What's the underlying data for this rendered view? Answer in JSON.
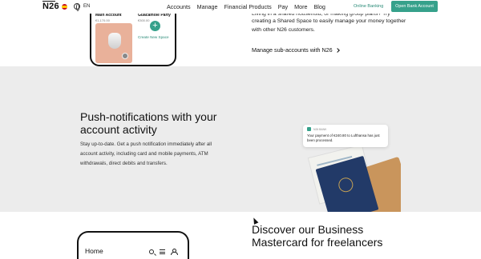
{
  "nav": {
    "logo": "N26",
    "language": "EN",
    "menu": [
      "Accounts",
      "Manage",
      "Financial Products",
      "Pay",
      "More",
      "Blog"
    ],
    "online_banking": "Online Banking",
    "open_account": "Open Bank Account"
  },
  "phone_top": {
    "accounts": [
      {
        "name": "Main Account",
        "amount": "€1,170.00"
      },
      {
        "name": "Guacamole Party",
        "amount": "€300.00"
      }
    ],
    "create_label": "Create New Space"
  },
  "shared_space": {
    "text_cut": "Living in a shared household, or making group plans? Try",
    "text": "creating a Shared Space to easily manage your money together with other N26 customers.",
    "link": "Manage sub-accounts with N26"
  },
  "push": {
    "title": "Push-notifications with your account activity",
    "body": "Stay up-to-date. Get a push notification immediately after all account activity, including card and mobile payments, ATM withdrawals, direct debits and transfers.",
    "notification": {
      "app": "N26 BANK",
      "message": "Your payment of €240.80 to Lufthansa has just been processed."
    }
  },
  "business": {
    "phone_home": "Home",
    "title": "Discover our Business Mastercard for freelancers"
  },
  "colors": {
    "accent": "#36a18b",
    "grey_bg": "#ececec"
  }
}
